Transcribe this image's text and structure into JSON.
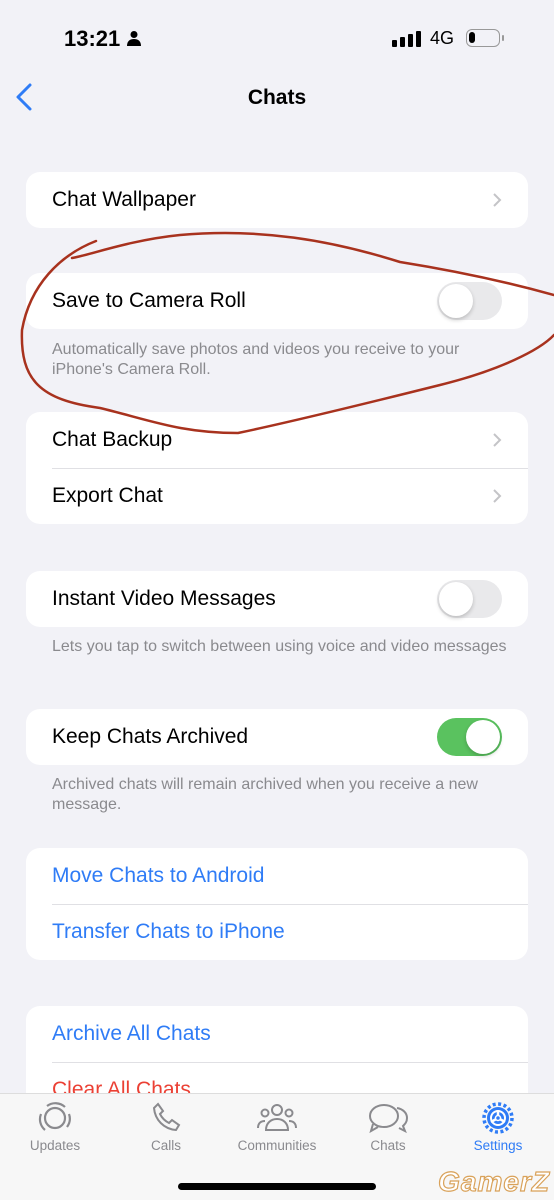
{
  "status": {
    "time": "13:21",
    "network": "4G"
  },
  "nav": {
    "title": "Chats"
  },
  "sections": {
    "wallpaper": "Chat Wallpaper",
    "camera_roll": {
      "label": "Save to Camera Roll",
      "on": false,
      "footer": "Automatically save photos and videos you receive to your iPhone's Camera Roll."
    },
    "backup": "Chat Backup",
    "export": "Export Chat",
    "instant_video": {
      "label": "Instant Video Messages",
      "on": false,
      "footer": "Lets you tap to switch between using voice and video messages"
    },
    "keep_archived": {
      "label": "Keep Chats Archived",
      "on": true,
      "footer": "Archived chats will remain archived when you receive a new message."
    },
    "move_android": "Move Chats to Android",
    "transfer_iphone": "Transfer Chats to iPhone",
    "archive_all": "Archive All Chats",
    "clear_all": "Clear All Chats"
  },
  "tabs": [
    {
      "label": "Updates",
      "icon": "updates-icon"
    },
    {
      "label": "Calls",
      "icon": "phone-icon"
    },
    {
      "label": "Communities",
      "icon": "communities-icon"
    },
    {
      "label": "Chats",
      "icon": "chat-bubbles-icon"
    },
    {
      "label": "Settings",
      "icon": "gear-icon",
      "active": true
    }
  ],
  "colors": {
    "accent": "#2f7cf6",
    "toggle_on": "#5ac25f",
    "destructive": "#eb4034",
    "annotation": "#a8321e"
  },
  "watermark": "GamerZ"
}
